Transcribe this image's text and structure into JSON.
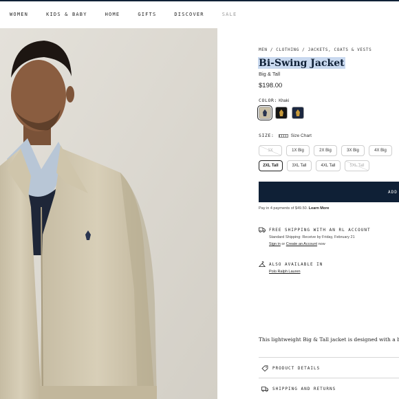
{
  "nav": {
    "items": [
      {
        "label": "WOMEN",
        "name": "nav-women"
      },
      {
        "label": "KIDS & BABY",
        "name": "nav-kids-baby"
      },
      {
        "label": "HOME",
        "name": "nav-home"
      },
      {
        "label": "GIFTS",
        "name": "nav-gifts"
      },
      {
        "label": "DISCOVER",
        "name": "nav-discover"
      },
      {
        "label": "SALE",
        "name": "nav-sale"
      }
    ]
  },
  "product": {
    "breadcrumb": "MEN / CLOTHING / JACKETS, COATS & VESTS",
    "title": "Bi-Swing Jacket",
    "subtitle": "Big & Tall",
    "price": "$198.00",
    "color_label": "COLOR:",
    "color_value": "Khaki",
    "swatches": [
      {
        "name": "khaki",
        "color": "#c9bfa6",
        "logo_color": "#2a3550",
        "selected": true
      },
      {
        "name": "black",
        "color": "#151515",
        "logo_color": "#c79a3b",
        "selected": false
      },
      {
        "name": "navy",
        "color": "#1b2740",
        "logo_color": "#c79a3b",
        "selected": false
      }
    ],
    "size_label": "SIZE:",
    "size_chart": "Size Chart",
    "sizes": [
      {
        "label": "1X",
        "state": "disabled"
      },
      {
        "label": "1X Big",
        "state": "available"
      },
      {
        "label": "2X Big",
        "state": "available"
      },
      {
        "label": "3X Big",
        "state": "available"
      },
      {
        "label": "4X Big",
        "state": "available"
      },
      {
        "label": "2XL Tall",
        "state": "selected"
      },
      {
        "label": "3XL Tall",
        "state": "available"
      },
      {
        "label": "4XL Tall",
        "state": "available"
      },
      {
        "label": "5XL Tall",
        "state": "disabled"
      }
    ],
    "add_button": "ADD",
    "klarna_text": "Pay in 4 payments of $49.50.",
    "klarna_link": "Learn More",
    "shipping": {
      "title": "FREE SHIPPING WITH AN RL ACCOUNT",
      "standard": "Standard Shipping: Receive by Friday, February 21",
      "sign_in": "Sign in",
      "or": "or",
      "create": "Create an Account",
      "now": "now"
    },
    "availability": {
      "title": "ALSO AVAILABLE IN",
      "link": "Polo Ralph Lauren"
    },
    "description": "This lightweight Big & Tall jacket is designed with a bi-swing",
    "accordion": [
      {
        "label": "PRODUCT DETAILS",
        "icon": "tag-icon"
      },
      {
        "label": "SHIPPING AND RETURNS",
        "icon": "truck-icon"
      }
    ]
  },
  "colors": {
    "navy": "#0f2036",
    "highlight": "#c9d9ef"
  }
}
